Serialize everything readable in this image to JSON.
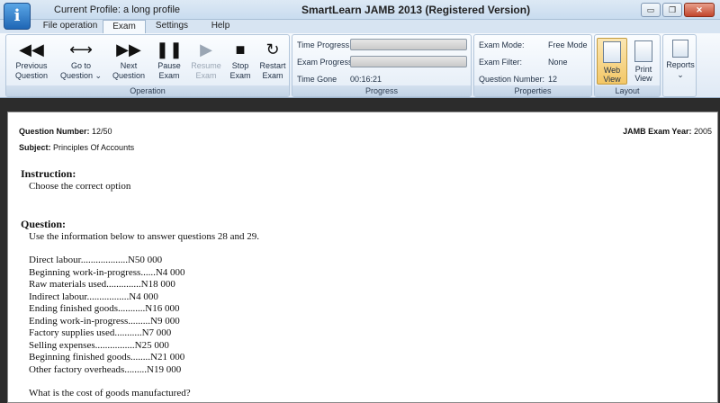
{
  "window": {
    "title": "SmartLearn JAMB 2013 (Registered Version)",
    "profile": "Current Profile: a long profile",
    "icon": "info-icon",
    "controls": {
      "minimize": "▭",
      "restore": "❐",
      "close": "✕"
    }
  },
  "tabs": [
    {
      "label": "File operation"
    },
    {
      "label": "Exam",
      "active": true
    },
    {
      "label": "Settings"
    },
    {
      "label": "Help"
    }
  ],
  "ribbon": {
    "operation": {
      "label": "Operation",
      "buttons": [
        {
          "label1": "Previous",
          "label2": "Question",
          "icon": "rewind-icon",
          "glyph": "◀◀"
        },
        {
          "label1": "Go to",
          "label2": "Question ⌄",
          "icon": "horizontal-arrows-icon",
          "glyph": "⟷"
        },
        {
          "label1": "Next",
          "label2": "Question",
          "icon": "fast-forward-icon",
          "glyph": "▶▶"
        },
        {
          "label1": "Pause",
          "label2": "Exam",
          "icon": "pause-icon",
          "glyph": "❚❚"
        },
        {
          "label1": "Resume",
          "label2": "Exam",
          "icon": "play-icon",
          "glyph": "▶",
          "disabled": true
        },
        {
          "label1": "Stop",
          "label2": "Exam",
          "icon": "stop-icon",
          "glyph": "■"
        },
        {
          "label1": "Restart",
          "label2": "Exam",
          "icon": "restart-icon",
          "glyph": "↻"
        }
      ]
    },
    "progress": {
      "label": "Progress",
      "time_progress_label": "Time Progress",
      "time_progress_value": 0,
      "exam_progress_label": "Exam Progress",
      "exam_progress_value": 0,
      "time_gone_label": "Time Gone",
      "time_gone_value": "00:16:21"
    },
    "properties": {
      "label": "Properties",
      "exam_mode_label": "Exam Mode:",
      "exam_mode_value": "Free Mode",
      "exam_filter_label": "Exam Filter:",
      "exam_filter_value": "None",
      "question_number_label": "Question Number:",
      "question_number_value": "12"
    },
    "layout": {
      "label": "Layout",
      "web_view1": "Web",
      "web_view2": "View",
      "print_view1": "Print",
      "print_view2": "View"
    },
    "reports": {
      "label": "Reports",
      "chevron": "⌄",
      "icon": "reports-icon"
    }
  },
  "question": {
    "number_label": "Question Number:",
    "number_value": "12/50",
    "subject_label": "Subject:",
    "subject_value": "Principles Of Accounts",
    "year_label": "JAMB Exam Year:",
    "year_value": "2005",
    "instruction_heading": "Instruction:",
    "instruction_text": "Choose the correct option",
    "question_heading": "Question:",
    "intro": "Use the information below to answer questions 28 and 29.",
    "items": [
      "Direct labour...................N50 000",
      "Beginning work-in-progress......N4 000",
      "Raw materials used..............N18 000",
      "Indirect labour.................N4 000",
      "Ending finished goods...........N16 000",
      "Ending work-in-progress.........N9 000",
      "Factory supplies used...........N7 000",
      "Selling expenses................N25 000",
      "Beginning finished goods........N21 000",
      "Other factory overheads.........N19 000"
    ],
    "prompt": "What is the cost of goods manufactured?"
  }
}
